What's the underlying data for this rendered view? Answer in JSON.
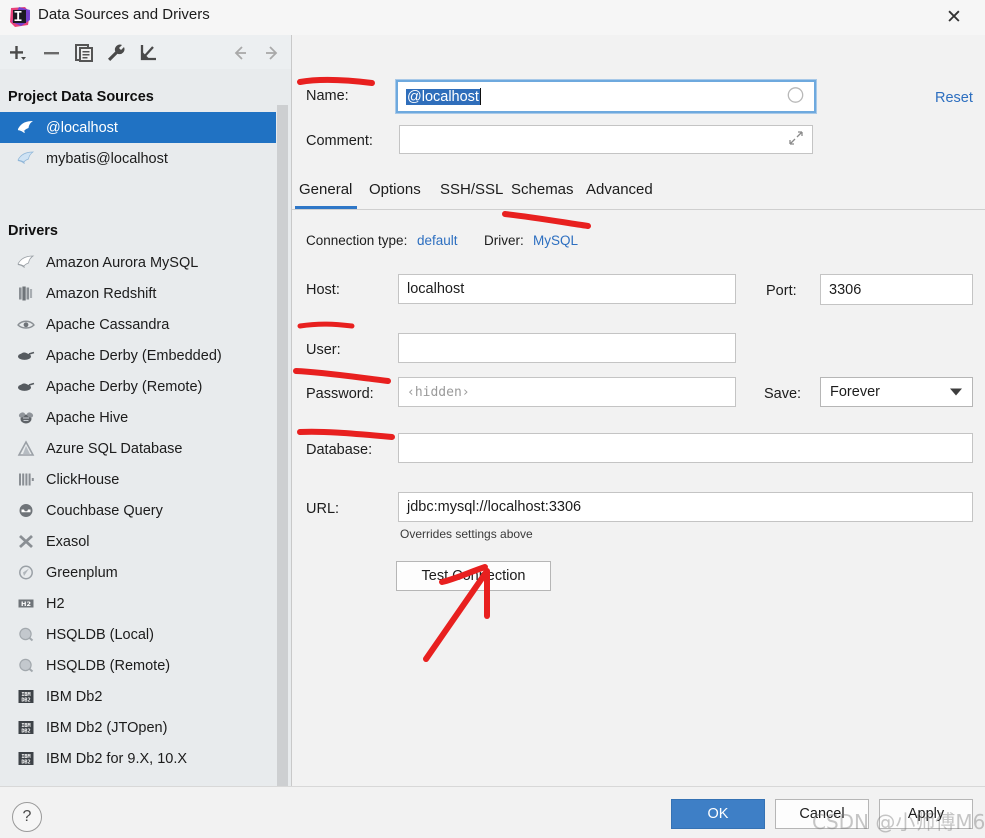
{
  "window": {
    "title": "Data Sources and Drivers",
    "close_label": "✕",
    "app_icon": "intellij-idea-icon"
  },
  "toolbar": {
    "items": [
      {
        "name": "add-button",
        "glyph": "+"
      },
      {
        "name": "remove-button",
        "glyph": "−"
      },
      {
        "name": "copy-button",
        "glyph": "copy-icon"
      },
      {
        "name": "properties-button",
        "glyph": "wrench-icon"
      },
      {
        "name": "import-button",
        "glyph": "import-arrow-icon"
      },
      {
        "name": "back-button",
        "glyph": "←"
      },
      {
        "name": "forward-button",
        "glyph": "→"
      }
    ]
  },
  "sidebar": {
    "project_sources_title": "Project Data Sources",
    "data_sources": [
      {
        "label": "@localhost",
        "icon": "mysql-dolphin-icon",
        "selected": true
      },
      {
        "label": "mybatis@localhost",
        "icon": "mysql-dolphin-icon",
        "selected": false
      }
    ],
    "drivers_title": "Drivers",
    "drivers": [
      {
        "label": "Amazon Aurora MySQL",
        "icon": "aurora-mysql-icon"
      },
      {
        "label": "Amazon Redshift",
        "icon": "redshift-icon"
      },
      {
        "label": "Apache Cassandra",
        "icon": "cassandra-eye-icon"
      },
      {
        "label": "Apache Derby (Embedded)",
        "icon": "derby-hat-icon"
      },
      {
        "label": "Apache Derby (Remote)",
        "icon": "derby-hat-icon"
      },
      {
        "label": "Apache Hive",
        "icon": "hive-bee-icon"
      },
      {
        "label": "Azure SQL Database",
        "icon": "azure-triangle-icon"
      },
      {
        "label": "ClickHouse",
        "icon": "clickhouse-bars-icon"
      },
      {
        "label": "Couchbase Query",
        "icon": "couchbase-icon"
      },
      {
        "label": "Exasol",
        "icon": "exasol-x-icon"
      },
      {
        "label": "Greenplum",
        "icon": "greenplum-icon"
      },
      {
        "label": "H2",
        "icon": "h2-icon"
      },
      {
        "label": "HSQLDB (Local)",
        "icon": "hsqldb-icon"
      },
      {
        "label": "HSQLDB (Remote)",
        "icon": "hsqldb-icon"
      },
      {
        "label": "IBM Db2",
        "icon": "ibm-db2-icon"
      },
      {
        "label": "IBM Db2 (JTOpen)",
        "icon": "ibm-db2-icon"
      },
      {
        "label": "IBM Db2 for 9.X, 10.X",
        "icon": "ibm-db2-icon"
      }
    ]
  },
  "form": {
    "name_label": "Name:",
    "name_value": "@localhost",
    "comment_label": "Comment:",
    "comment_value": "",
    "reset_label": "Reset",
    "expand_icon": "expand-arrows-icon",
    "status_icon": "connection-status-circle-icon"
  },
  "tabs": {
    "items": [
      {
        "label": "General",
        "active": true
      },
      {
        "label": "Options",
        "active": false
      },
      {
        "label": "SSH/SSL",
        "active": false
      },
      {
        "label": "Schemas",
        "active": false
      },
      {
        "label": "Advanced",
        "active": false
      }
    ]
  },
  "general": {
    "connection_type_label": "Connection type:",
    "connection_type_value": "default",
    "driver_label": "Driver:",
    "driver_value": "MySQL",
    "host_label": "Host:",
    "host_value": "localhost",
    "port_label": "Port:",
    "port_value": "3306",
    "user_label": "User:",
    "user_value": "",
    "password_label": "Password:",
    "password_placeholder": "‹hidden›",
    "save_label": "Save:",
    "save_value": "Forever",
    "database_label": "Database:",
    "database_value": "",
    "url_label": "URL:",
    "url_value": "jdbc:mysql://localhost:3306",
    "url_hint": "Overrides settings above",
    "test_connection_label": "Test Connection"
  },
  "footer": {
    "help_label": "?",
    "ok_label": "OK",
    "cancel_label": "Cancel",
    "apply_label": "Apply"
  },
  "annotations": {
    "color": "#e8201f",
    "underlines": [
      "name-underline",
      "driver-underline",
      "user-underline",
      "password-underline",
      "database-underline"
    ],
    "arrow": "test-connection-arrow"
  },
  "watermark": {
    "text": "CSDN @小师傅M6"
  },
  "colors": {
    "selection_blue": "#2072c3",
    "link_blue": "#2d6fc0",
    "primary_button": "#3e7fc6",
    "annotation_red": "#e8201f",
    "panel_bg": "#f2f2f2",
    "sidebar_bg": "#e8ebed"
  }
}
